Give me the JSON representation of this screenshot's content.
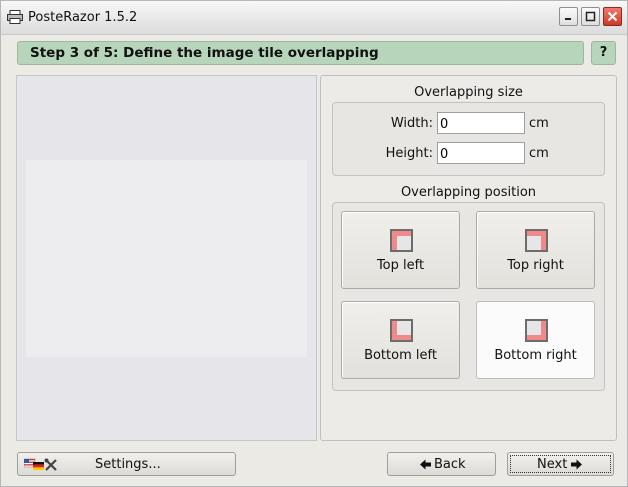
{
  "window": {
    "title": "PosteRazor 1.5.2",
    "controls": {
      "minimize": "minimize-icon",
      "maximize": "maximize-icon",
      "close": "close-icon"
    }
  },
  "step": {
    "title": "Step 3 of 5: Define the image tile overlapping",
    "help_label": "?"
  },
  "overlapping_size": {
    "title": "Overlapping size",
    "width_label": "Width:",
    "width_value": "0",
    "height_label": "Height:",
    "height_value": "0",
    "unit": "cm"
  },
  "overlapping_position": {
    "title": "Overlapping position",
    "options": [
      {
        "label": "Top left",
        "icon": "overlap-top-left-icon"
      },
      {
        "label": "Top right",
        "icon": "overlap-top-right-icon"
      },
      {
        "label": "Bottom left",
        "icon": "overlap-bottom-left-icon"
      },
      {
        "label": "Bottom right",
        "icon": "overlap-bottom-right-icon"
      }
    ],
    "selected": "Bottom right"
  },
  "footer": {
    "settings_label": "Settings...",
    "settings_icon": "flags-and-tools-icon",
    "back_label": "Back",
    "next_label": "Next"
  },
  "colors": {
    "step_bar": "#b7d5ba",
    "overlap_fill": "#f08a8a",
    "tile_fill": "#e6e6e6",
    "tile_border": "#6c6c6c"
  }
}
